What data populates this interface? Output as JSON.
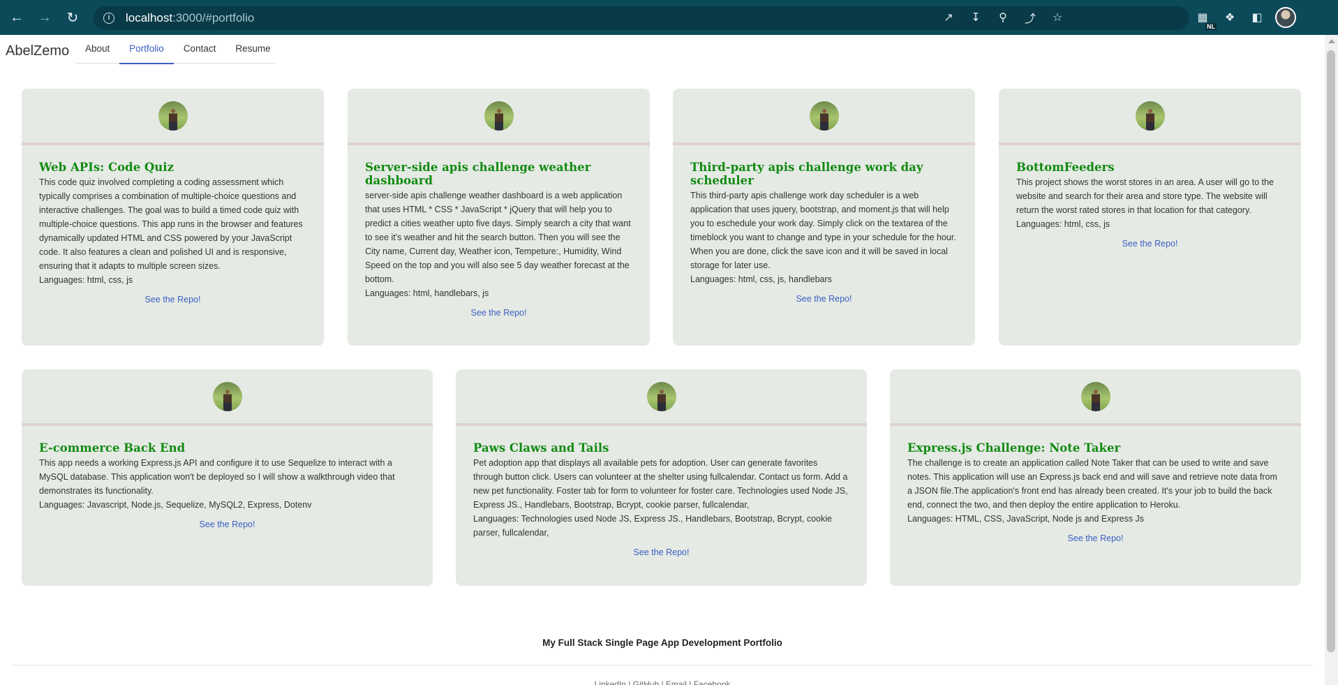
{
  "browser": {
    "url_host": "localhost",
    "url_rest": ":3000/#portfolio",
    "profile_badge": "NL"
  },
  "header": {
    "brand": "AbelZemo",
    "nav": [
      {
        "label": "About"
      },
      {
        "label": "Portfolio",
        "active": true
      },
      {
        "label": "Contact"
      },
      {
        "label": "Resume"
      }
    ]
  },
  "projects": [
    {
      "title": "Web APIs: Code Quiz",
      "description": "This code quiz involved completing a coding assessment which typically comprises a combination of multiple-choice questions and interactive challenges. The goal was to build a timed code quiz with multiple-choice questions. This app runs in the browser and features dynamically updated HTML and CSS powered by your JavaScript code. It also features a clean and polished UI and is responsive, ensuring that it adapts to multiple screen sizes.",
      "languages": "Languages: html, css, js",
      "link": "See the Repo!"
    },
    {
      "title": "Server-side apis challenge weather dashboard",
      "description": "server-side apis challenge weather dashboard is a web application that uses HTML * CSS * JavaScript * jQuery that will help you to predict a cities weather upto five days. Simply search a city that want to see it's weather and hit the search button. Then you will see the City name, Current day, Weather icon, Tempeture:, Humidity, Wind Speed on the top and you will also see 5 day weather forecast at the bottom.",
      "languages": "Languages: html, handlebars, js",
      "link": "See the Repo!"
    },
    {
      "title": "Third-party apis challenge work day scheduler",
      "description": "This third-party apis challenge work day scheduler is a web application that uses jquery, bootstrap, and moment.js that will help you to eschedule your work day. Simply click on the textarea of the timeblock you want to change and type in your schedule for the hour. When you are done, click the save icon and it will be saved in local storage for later use.",
      "languages": "Languages: html, css, js, handlebars",
      "link": "See the Repo!"
    },
    {
      "title": "BottomFeeders",
      "description": "This project shows the worst stores in an area. A user will go to the website and search for their area and store type. The website will return the worst rated stores in that location for that category.",
      "languages": "Languages: html, css, js",
      "link": "See the Repo!"
    },
    {
      "title": "E-commerce Back End",
      "description": "This app needs a working Express.js API and configure it to use Sequelize to interact with a MySQL database. This application won't be deployed so I will show a walkthrough video that demonstrates its functionality.",
      "languages": "Languages: Javascript, Node.js, Sequelize, MySQL2, Express, Dotenv",
      "link": "See the Repo!"
    },
    {
      "title": "Paws Claws and Tails",
      "description": "Pet adoption app that displays all available pets for adoption. User can generate favorites through button click. Users can volunteer at the shelter using fullcalendar. Contact us form. Add a new pet functionality. Foster tab for form to volunteer for foster care. Technologies used Node JS, Express JS., Handlebars, Bootstrap, Bcrypt, cookie parser, fullcalendar,",
      "languages": "Languages: Technologies used Node JS, Express JS., Handlebars, Bootstrap, Bcrypt, cookie parser, fullcalendar,",
      "link": "See the Repo!"
    },
    {
      "title": "Express.js Challenge: Note Taker",
      "description": "The challenge is to create an application called Note Taker that can be used to write and save notes. This application will use an Express.js back end and will save and retrieve note data from a JSON file.The application's front end has already been created. It's your job to build the back end, connect the two, and then deploy the entire application to Heroku.",
      "languages": "Languages: HTML, CSS, JavaScript, Node js and Express Js",
      "link": "See the Repo!"
    }
  ],
  "footer": {
    "title": "My Full Stack Single Page App Development Portfolio",
    "links": "LinkedIn | GitHub | Email | Facebook"
  }
}
